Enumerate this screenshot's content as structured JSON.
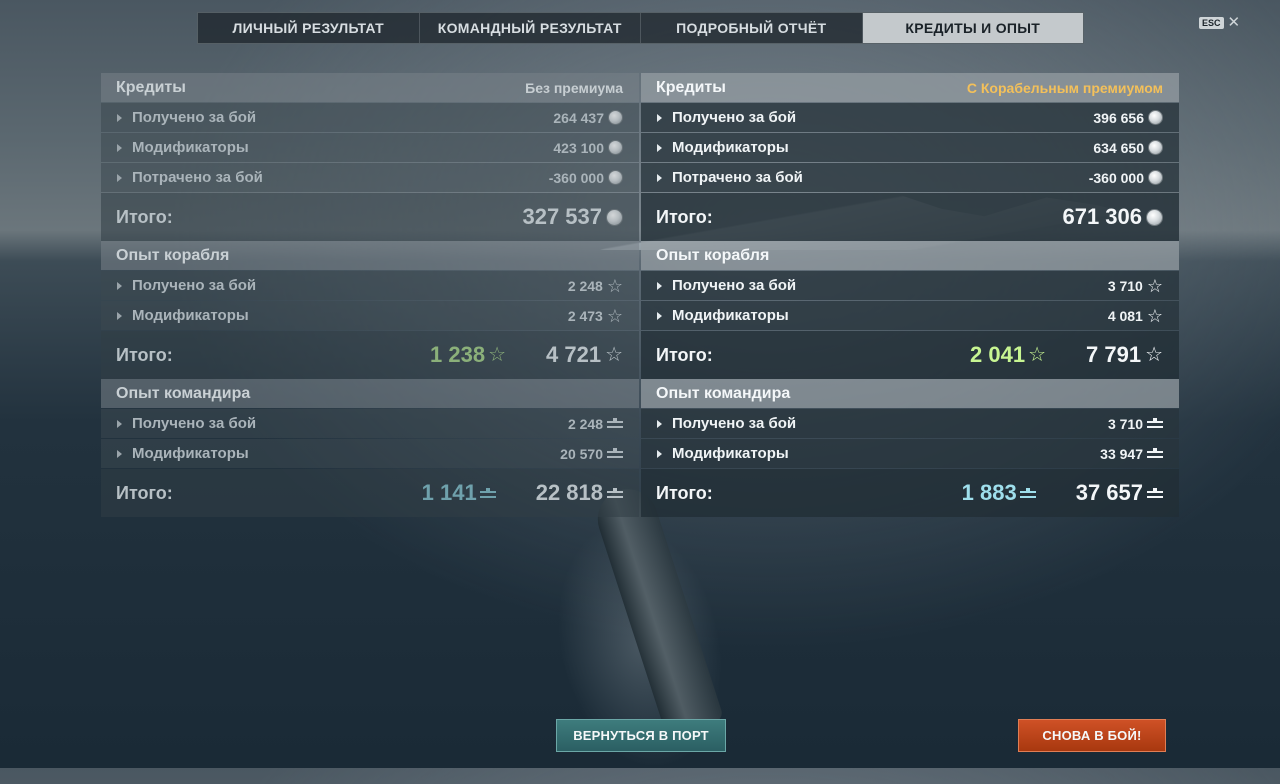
{
  "tabs": [
    {
      "label": "ЛИЧНЫЙ РЕЗУЛЬТАТ"
    },
    {
      "label": "КОМАНДНЫЙ РЕЗУЛЬТАТ"
    },
    {
      "label": "ПОДРОБНЫЙ ОТЧЁТ"
    },
    {
      "label": "КРЕДИТЫ И ОПЫТ"
    }
  ],
  "active_tab": 3,
  "esc": {
    "badge": "ESC",
    "close": "✕"
  },
  "left": {
    "credits": {
      "title": "Кредиты",
      "subtitle": "Без премиума",
      "rows": [
        {
          "label": "Получено за бой",
          "value": "264 437"
        },
        {
          "label": "Модификаторы",
          "value": "423 100"
        },
        {
          "label": "Потрачено за бой",
          "value": "-360 000"
        }
      ],
      "total_label": "Итого:",
      "total": "327 537"
    },
    "ship_xp": {
      "title": "Опыт корабля",
      "rows": [
        {
          "label": "Получено за бой",
          "value": "2 248"
        },
        {
          "label": "Модификаторы",
          "value": "2 473"
        }
      ],
      "total_label": "Итого:",
      "bonus": "1 238",
      "total": "4 721"
    },
    "commander_xp": {
      "title": "Опыт командира",
      "rows": [
        {
          "label": "Получено за бой",
          "value": "2 248"
        },
        {
          "label": "Модификаторы",
          "value": "20 570"
        }
      ],
      "total_label": "Итого:",
      "bonus": "1 141",
      "total": "22 818"
    }
  },
  "right": {
    "credits": {
      "title": "Кредиты",
      "subtitle": "С Корабельным премиумом",
      "rows": [
        {
          "label": "Получено за бой",
          "value": "396 656"
        },
        {
          "label": "Модификаторы",
          "value": "634 650"
        },
        {
          "label": "Потрачено за бой",
          "value": "-360 000"
        }
      ],
      "total_label": "Итого:",
      "total": "671 306"
    },
    "ship_xp": {
      "title": "Опыт корабля",
      "rows": [
        {
          "label": "Получено за бой",
          "value": "3 710"
        },
        {
          "label": "Модификаторы",
          "value": "4 081"
        }
      ],
      "total_label": "Итого:",
      "bonus": "2 041",
      "total": "7 791"
    },
    "commander_xp": {
      "title": "Опыт командира",
      "rows": [
        {
          "label": "Получено за бой",
          "value": "3 710"
        },
        {
          "label": "Модификаторы",
          "value": "33 947"
        }
      ],
      "total_label": "Итого:",
      "bonus": "1 883",
      "total": "37 657"
    }
  },
  "icons": {
    "credits": "silver-coin-icon",
    "ship_xp": "star-icon",
    "commander_xp": "commander-xp-icon"
  },
  "colors": {
    "premium_label": "#f3c05a",
    "free_xp_bonus": "#c7f592",
    "commander_bonus": "#9fdfec",
    "battle_button": "#c2461b",
    "port_button": "#347071"
  },
  "buttons": {
    "port": "ВЕРНУТЬСЯ В ПОРТ",
    "battle": "СНОВА В БОЙ!"
  }
}
